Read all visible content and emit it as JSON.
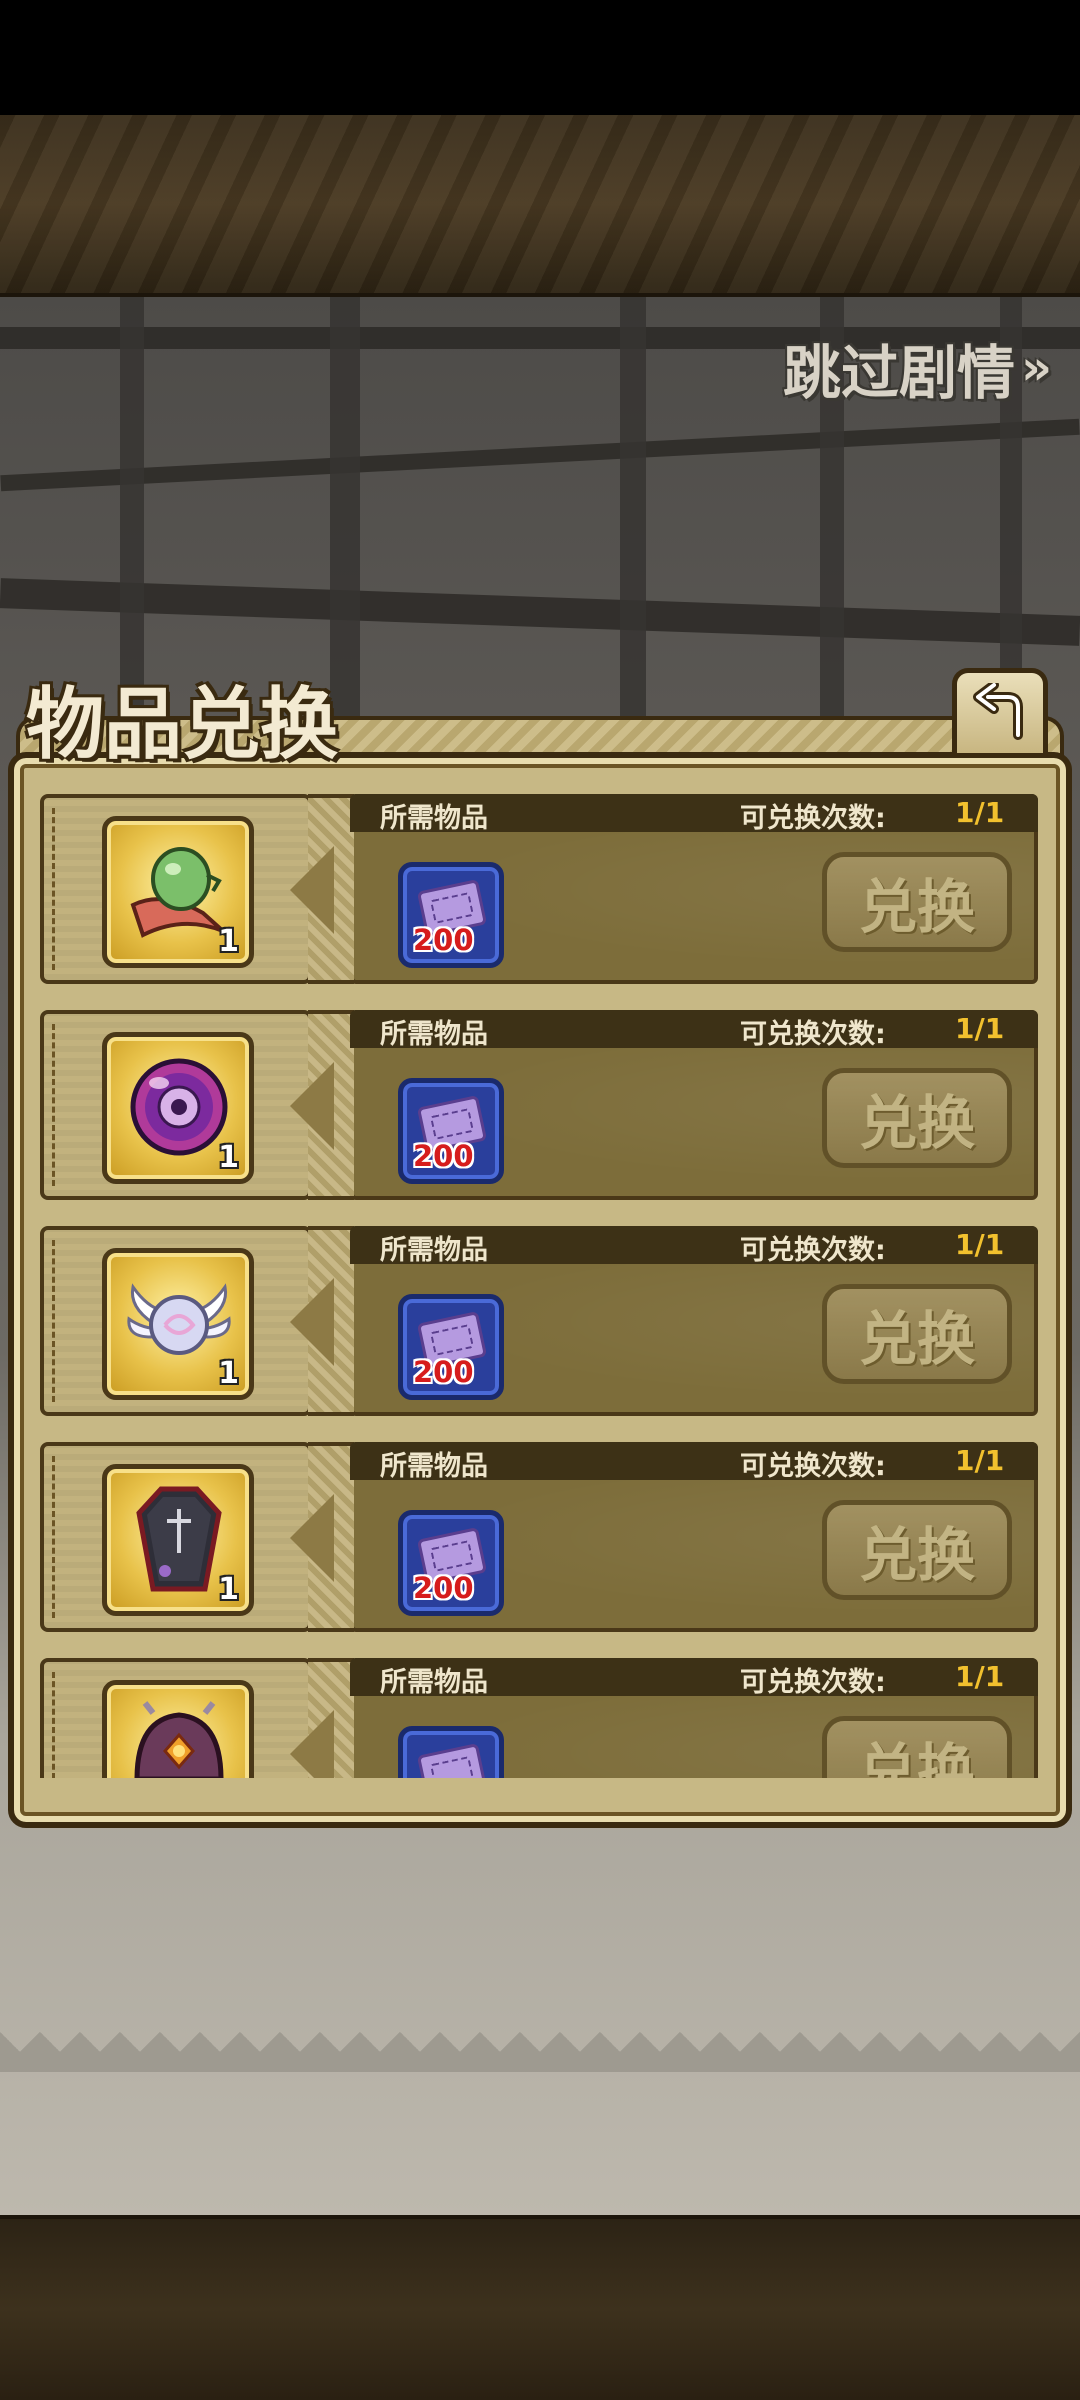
{
  "skip_story": {
    "label": "跳过剧情",
    "chevron": "»"
  },
  "panel": {
    "title": "物品兑换",
    "back_icon": "return-arrow-icon"
  },
  "rows": [
    {
      "reward_icon": "green-gem-scroll-icon",
      "reward_qty": "1",
      "req_label": "所需物品",
      "cost_icon": "purple-ticket-icon",
      "cost_qty": "200",
      "count_label": "可兑换次数:",
      "count_value": "1/1",
      "button_label": "兑换"
    },
    {
      "reward_icon": "purple-orb-icon",
      "reward_qty": "1",
      "req_label": "所需物品",
      "cost_icon": "purple-ticket-icon",
      "cost_qty": "200",
      "count_label": "可兑换次数:",
      "count_value": "1/1",
      "button_label": "兑换"
    },
    {
      "reward_icon": "winged-orb-icon",
      "reward_qty": "1",
      "req_label": "所需物品",
      "cost_icon": "purple-ticket-icon",
      "cost_qty": "200",
      "count_label": "可兑换次数:",
      "count_value": "1/1",
      "button_label": "兑换"
    },
    {
      "reward_icon": "coffin-icon",
      "reward_qty": "1",
      "req_label": "所需物品",
      "cost_icon": "purple-ticket-icon",
      "cost_qty": "200",
      "count_label": "可兑换次数:",
      "count_value": "1/1",
      "button_label": "兑换"
    },
    {
      "reward_icon": "helmet-icon",
      "req_label": "所需物品",
      "cost_icon": "purple-ticket-icon",
      "count_label": "可兑换次数:",
      "count_value": "1/1",
      "button_label": "兑换"
    }
  ],
  "colors": {
    "count_value": "#f2c12e",
    "cost_qty": "#d61c1c",
    "panel_bg": "#c7b885"
  }
}
